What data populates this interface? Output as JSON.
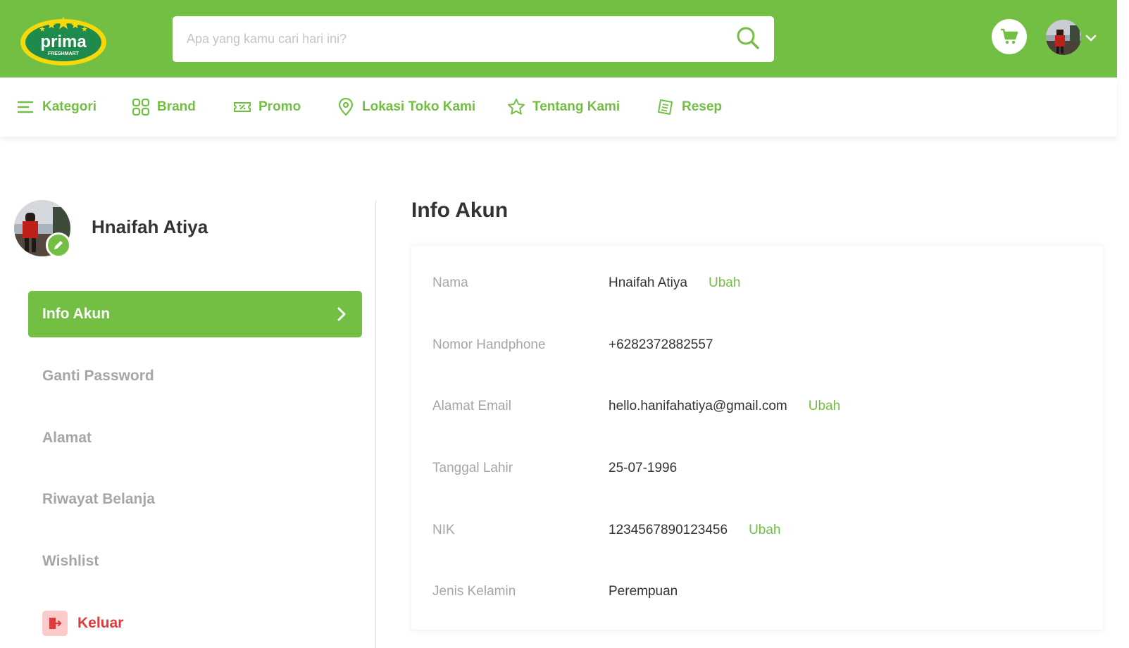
{
  "brand": {
    "logo_text": "prima",
    "logo_subtext": "FRESHMART",
    "primary_color": "#72BF44",
    "danger_color": "#E03A3A"
  },
  "search": {
    "placeholder": "Apa yang kamu cari hari ini?",
    "value": ""
  },
  "header": {
    "cart_icon": "cart-icon",
    "user_menu_icon": "chevron-down-icon"
  },
  "nav": [
    {
      "label": "Kategori",
      "icon": "menu-lines-icon"
    },
    {
      "label": "Brand",
      "icon": "grid-icon"
    },
    {
      "label": "Promo",
      "icon": "ticket-icon"
    },
    {
      "label": "Lokasi Toko Kami",
      "icon": "map-pin-icon"
    },
    {
      "label": "Tentang Kami",
      "icon": "star-icon"
    },
    {
      "label": "Resep",
      "icon": "recipe-icon"
    }
  ],
  "profile": {
    "name": "Hnaifah Atiya"
  },
  "menu": [
    {
      "label": "Info Akun",
      "active": true
    },
    {
      "label": "Ganti Password"
    },
    {
      "label": "Alamat"
    },
    {
      "label": "Riwayat Belanja"
    },
    {
      "label": "Wishlist"
    }
  ],
  "logout_label": "Keluar",
  "main": {
    "title": "Info Akun"
  },
  "account_fields": [
    {
      "label": "Nama",
      "value": "Hnaifah Atiya",
      "action": "Ubah"
    },
    {
      "label": "Nomor Handphone",
      "value": "+6282372882557"
    },
    {
      "label": "Alamat Email",
      "value": "hello.hanifahatiya@gmail.com",
      "action": "Ubah"
    },
    {
      "label": "Tanggal Lahir",
      "value": "25-07-1996"
    },
    {
      "label": "NIK",
      "value": "1234567890123456",
      "action": "Ubah"
    },
    {
      "label": "Jenis Kelamin",
      "value": "Perempuan"
    }
  ]
}
